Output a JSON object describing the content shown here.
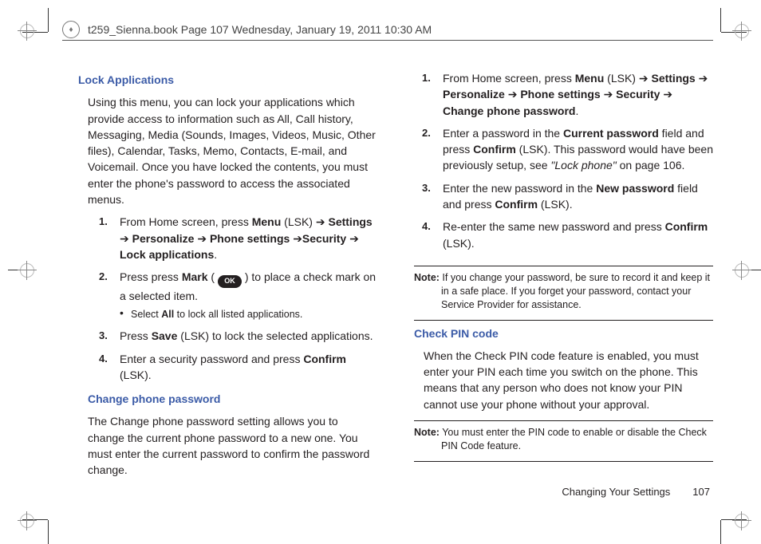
{
  "header": {
    "text": "t259_Sienna.book  Page 107  Wednesday, January 19, 2011  10:30 AM"
  },
  "left": {
    "h1": "Lock Applications",
    "intro": "Using this menu, you can lock your applications which provide access to information such as All, Call history, Messaging, Media (Sounds, Images, Videos, Music, Other files), Calendar, Tasks, Memo, Contacts, E-mail, and Voicemail. Once you have locked the contents, you must enter the phone's password to access the associated menus.",
    "step1": {
      "num": "1.",
      "pre": "From Home screen, press ",
      "menu": "Menu",
      "lsk": " (LSK) ",
      "arrow": "➔",
      "settings": " Settings ",
      "personalize": "Personalize ",
      "phone_settings": " Phone settings ",
      "security": "Security ",
      "lock_apps": "Lock applications",
      "period": "."
    },
    "step2": {
      "num": "2.",
      "pre": "Press press ",
      "mark": "Mark",
      "paren_open": " ( ",
      "ok": "OK",
      "paren_close": " ) to place a check mark on a selected item.",
      "bullet_pre": "Select ",
      "bullet_bold": "All",
      "bullet_post": " to lock all listed applications."
    },
    "step3": {
      "num": "3.",
      "pre": "Press ",
      "save": "Save",
      "post": " (LSK) to lock the selected applications."
    },
    "step4": {
      "num": "4.",
      "pre": "Enter a security password and press ",
      "confirm": "Confirm",
      "post": " (LSK)."
    },
    "h2": "Change phone password",
    "cpw_para": "The Change phone password setting allows you to change the current phone password to a new one. You must enter the current password to confirm the password change."
  },
  "right": {
    "step1": {
      "num": "1.",
      "pre": "From Home screen, press ",
      "menu": "Menu",
      "lsk": " (LSK) ",
      "arrow": "➔",
      "settings": " Settings ",
      "personalize": "Personalize ",
      "phone_settings": " Phone settings ",
      "security": " Security ",
      "change": " Change phone password",
      "period": "."
    },
    "step2": {
      "num": "2.",
      "pre": "Enter a password in the ",
      "cur": "Current password",
      "mid1": " field and press ",
      "confirm": "Confirm",
      "mid2": " (LSK). This password would have been previously setup, see ",
      "ref": "\"Lock phone\"",
      "post": " on page 106."
    },
    "step3": {
      "num": "3.",
      "pre": "Enter the new password in the ",
      "np": "New password",
      "mid": " field and press ",
      "confirm": "Confirm",
      "post": " (LSK)."
    },
    "step4": {
      "num": "4.",
      "pre": "Re-enter the same new password and press ",
      "confirm": "Confirm",
      "post": " (LSK)."
    },
    "note1_b": "Note:",
    "note1": " If you change your password, be sure to record it and keep it in a safe place. If you forget your password, contact your Service Provider for assistance.",
    "h_check": "Check PIN code",
    "check_para": "When the Check PIN code feature is enabled, you must enter your PIN each time you switch on the phone. This means that any person who does not know your PIN cannot use your phone without your approval.",
    "note2_b": "Note:",
    "note2": " You must enter the PIN code to enable or disable the Check PIN Code feature."
  },
  "footer": {
    "section": "Changing Your Settings",
    "page": "107"
  }
}
